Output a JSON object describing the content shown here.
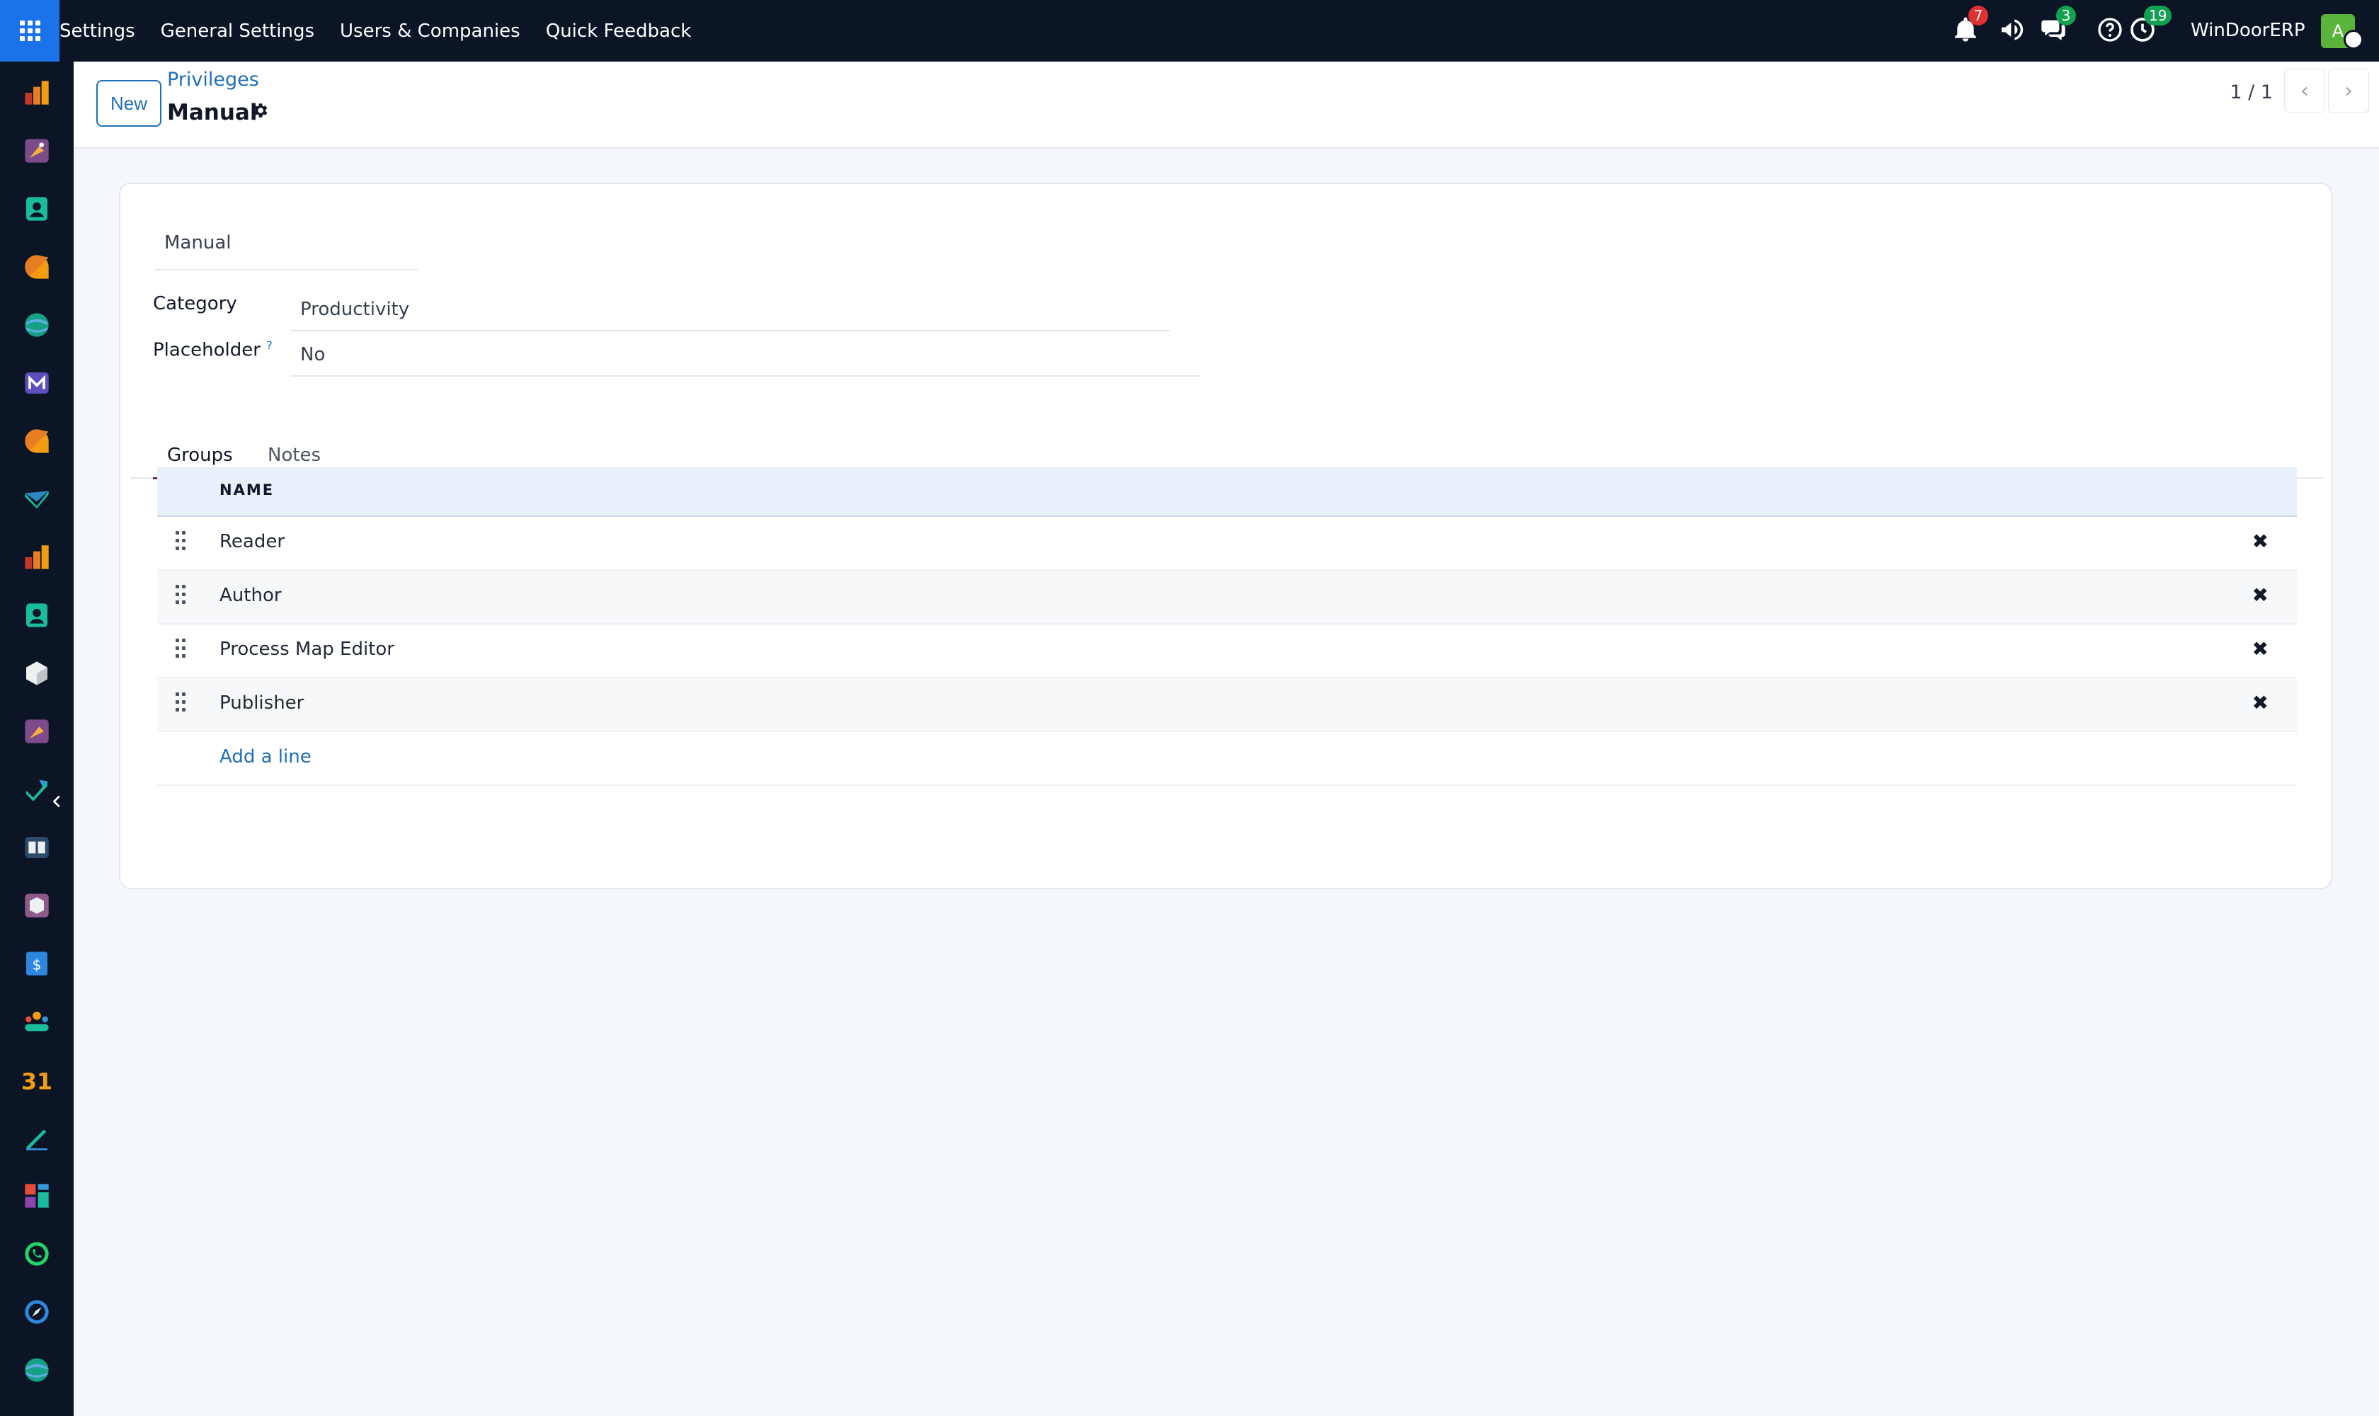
{
  "topbar": {
    "nav": [
      "Settings",
      "General Settings",
      "Users & Companies",
      "Quick Feedback"
    ],
    "notifications_count": "7",
    "messages_count": "3",
    "activities_count": "19",
    "company": "WinDoorERP",
    "avatar_letter": "A"
  },
  "control": {
    "new_label": "New",
    "breadcrumb": "Privileges",
    "title": "Manual",
    "pager": "1 / 1"
  },
  "form": {
    "name": "Manual",
    "category_label": "Category",
    "category_value": "Productivity",
    "placeholder_label": "Placeholder",
    "placeholder_help": "?",
    "placeholder_value": "No"
  },
  "tabs": [
    "Groups",
    "Notes"
  ],
  "groups": {
    "column": "NAME",
    "rows": [
      "Reader",
      "Author",
      "Process Map Editor",
      "Publisher"
    ],
    "add_line": "Add a line"
  },
  "sidebar_apps": [
    "dashboard-icon",
    "art-icon",
    "contacts-icon",
    "chat-icon",
    "sync-icon",
    "mail-icon",
    "discuss-icon",
    "check-icon",
    "dashboard-icon",
    "contacts-icon",
    "box-icon",
    "art-icon",
    "task-icon",
    "knowledge-icon",
    "inventory-icon",
    "accounting-icon",
    "team-icon",
    "calendar-icon",
    "sign-icon",
    "apps-icon",
    "whatsapp-icon",
    "compass-icon",
    "sync-icon"
  ],
  "colors": {
    "topbar": "#0b1526",
    "apps_button": "#1a73e8",
    "link": "#1f6fb5",
    "badge_red": "#e03131",
    "badge_green": "#12a150",
    "avatar": "#5ab43c"
  }
}
